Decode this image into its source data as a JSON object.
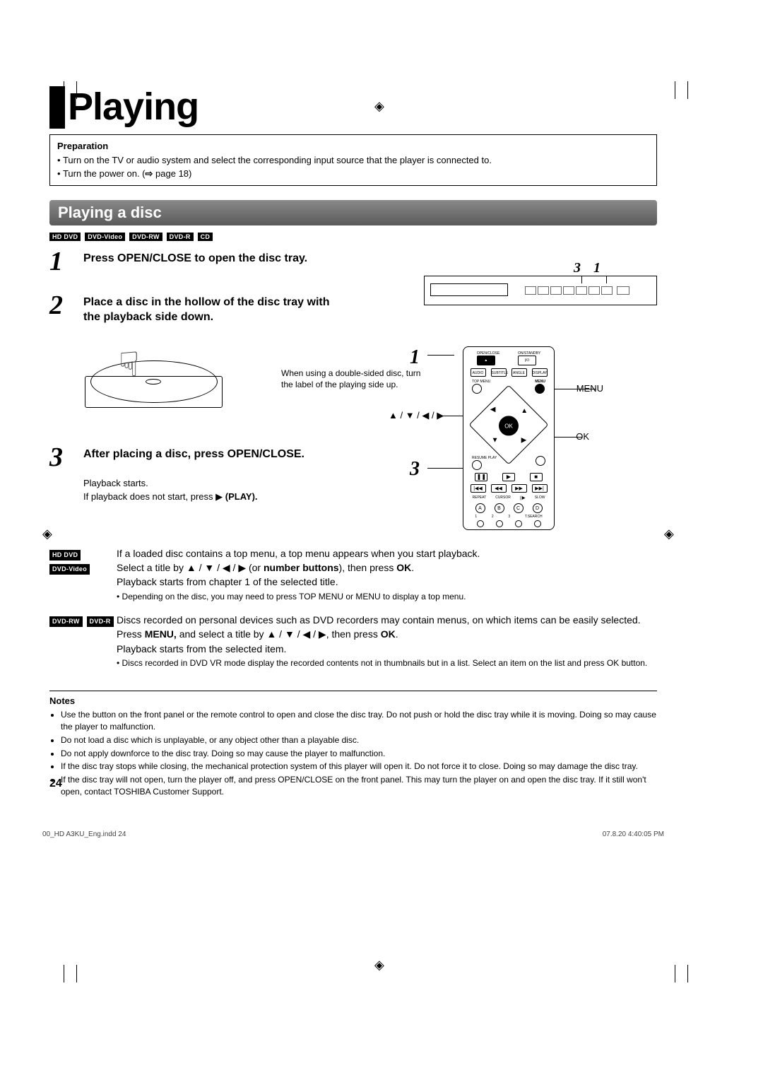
{
  "title": "Playing",
  "prep": {
    "hdr": "Preparation",
    "b1": "Turn on the TV or audio system and select the corresponding input source that the player is connected to.",
    "b2_a": "Turn the power on. (",
    "b2_b": " page 18)"
  },
  "section": "Playing a disc",
  "badges_all": [
    "HD DVD",
    "DVD-Video",
    "DVD-RW",
    "DVD-R",
    "CD"
  ],
  "steps": {
    "s1": {
      "num": "1",
      "text": "Press OPEN/CLOSE to open the disc tray."
    },
    "s2": {
      "num": "2",
      "text": "Place a disc in the hollow of the disc tray with the playback side down."
    },
    "s2_note": "When using a double-sided disc, turn the label of the playing side up.",
    "s3": {
      "num": "3",
      "text": "After placing a disc, press OPEN/CLOSE."
    },
    "s3_sub1": "Playback starts.",
    "s3_sub2a": "If playback does not start, press ",
    "s3_sub2b": " (PLAY)."
  },
  "pf_callouts": {
    "c3": "3",
    "c1": "1"
  },
  "remote_side": {
    "n1": "1",
    "n3": "3"
  },
  "remote_labels": {
    "menu": "MENU",
    "arrows": "▲ / ▼ / ◀ / ▶",
    "ok": "OK"
  },
  "remote_btns": {
    "open": "OPEN/CLOSE",
    "onstb": "ON/STANDBY",
    "stb": "|/⏻",
    "audio": "AUDIO",
    "subtitle": "SUBTITLE",
    "angle": "ANGLE",
    "display": "DISPLAY",
    "topmenu": "TOP MENU",
    "menu": "MENU",
    "ok": "OK",
    "resume": "RESUME PLAY",
    "repeat": "REPEAT",
    "cursor": "CURSOR",
    "slow": "SLOW",
    "a": "A",
    "b": "B",
    "c": "C",
    "d": "D",
    "tsearch": "T.SEARCH"
  },
  "info1": {
    "badges": [
      "HD DVD",
      "DVD-Video"
    ],
    "l1": "If a loaded disc contains a top menu, a top menu appears when you start playback.",
    "l2a": "Select a title by ▲ / ▼ / ◀ / ▶ (or ",
    "l2b": "number buttons",
    "l2c": "), then press ",
    "l2d": "OK",
    "l2e": ".",
    "l3": "Playback starts from chapter 1 of the selected title.",
    "sub": "Depending on the disc, you may need to press TOP MENU or MENU to display a top menu."
  },
  "info2": {
    "badges": [
      "DVD-RW",
      "DVD-R"
    ],
    "l1": "Discs recorded on personal devices such as DVD recorders may contain menus, on which items can be easily selected.",
    "l2a": "Press ",
    "l2b": "MENU,",
    "l2c": " and select a title by ▲ / ▼ / ◀ / ▶, then press ",
    "l2d": "OK",
    "l2e": ".",
    "l3": "Playback starts from the selected item.",
    "sub": "Discs recorded in DVD VR mode display the recorded contents not in thumbnails but in a list. Select an item on the list and press OK button."
  },
  "notes": {
    "hdr": "Notes",
    "items": [
      "Use the button on the front panel or the remote control to open and close the disc tray. Do not push or hold the disc tray while it is moving. Doing so may cause the player to malfunction.",
      "Do not load a disc which is unplayable, or any object other than a playable disc.",
      "Do not apply downforce to the disc tray. Doing so may cause the player to malfunction.",
      "If the disc tray stops while closing, the mechanical protection system of this player will open it. Do not force it to close. Doing so may damage the disc tray.",
      "If the disc tray will not open, turn the player off, and press OPEN/CLOSE on the front panel. This may turn the player on and open the disc tray. If it still won't open, contact TOSHIBA Customer Support."
    ]
  },
  "page_num": "24",
  "footer": {
    "left": "00_HD A3KU_Eng.indd   24",
    "right": "07.8.20   4:40:05 PM"
  }
}
